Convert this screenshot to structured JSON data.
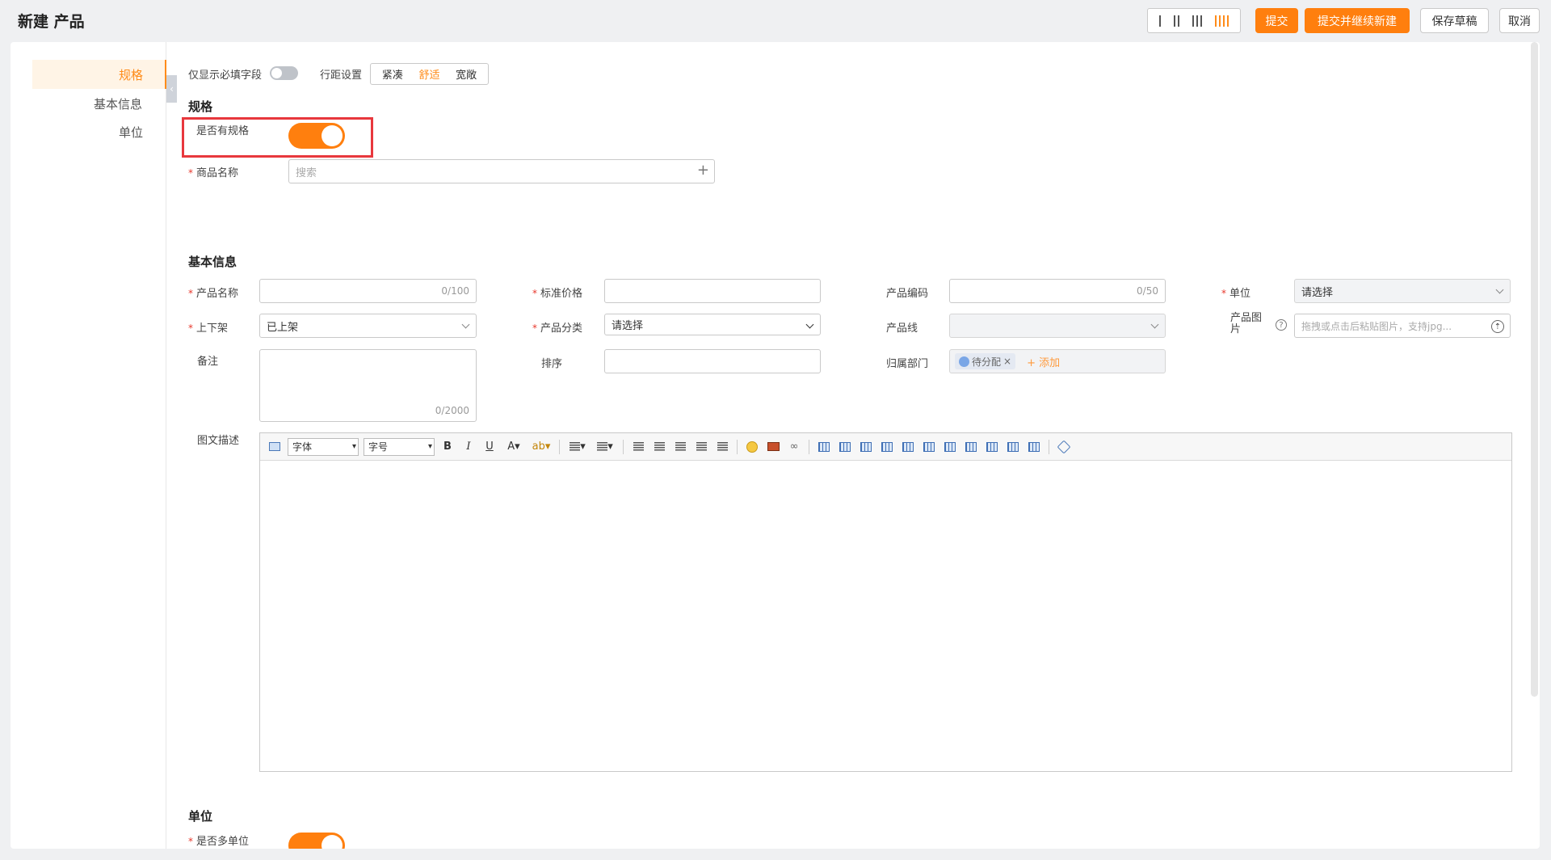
{
  "header": {
    "title": "新建 产品",
    "buttons": {
      "submit": "提交",
      "submit_continue": "提交并继续新建",
      "save_draft": "保存草稿",
      "cancel": "取消"
    }
  },
  "sidebar": {
    "items": [
      {
        "label": "规格",
        "active": true
      },
      {
        "label": "基本信息",
        "active": false
      },
      {
        "label": "单位",
        "active": false
      }
    ]
  },
  "options": {
    "required_only_label": "仅显示必填字段",
    "spacing_label": "行距设置",
    "spacing_options": [
      "紧凑",
      "舒适",
      "宽敞"
    ],
    "spacing_selected": "舒适"
  },
  "spec_section": {
    "title": "规格",
    "has_spec_label": "是否有规格",
    "goods_name_label": "商品名称",
    "goods_name_placeholder": "搜索"
  },
  "basic_section": {
    "title": "基本信息",
    "product_name_label": "产品名称",
    "product_name_counter": "0/100",
    "standard_price_label": "标准价格",
    "product_code_label": "产品编码",
    "product_code_counter": "0/50",
    "unit_label": "单位",
    "unit_value": "请选择",
    "listing_label": "上下架",
    "listing_value": "已上架",
    "category_label": "产品分类",
    "category_value": "请选择",
    "product_line_label": "产品线",
    "image_label": "产品图片",
    "image_placeholder": "拖拽或点击后粘贴图片，支持jpg...",
    "remark_label": "备注",
    "remark_counter": "0/2000",
    "sort_label": "排序",
    "department_label": "归属部门",
    "department_tag": "待分配",
    "department_add": "+ 添加",
    "rich_desc_label": "图文描述",
    "editor_font": "字体",
    "editor_size": "字号"
  },
  "unit_section": {
    "title": "单位",
    "multi_unit_label": "是否多单位"
  }
}
